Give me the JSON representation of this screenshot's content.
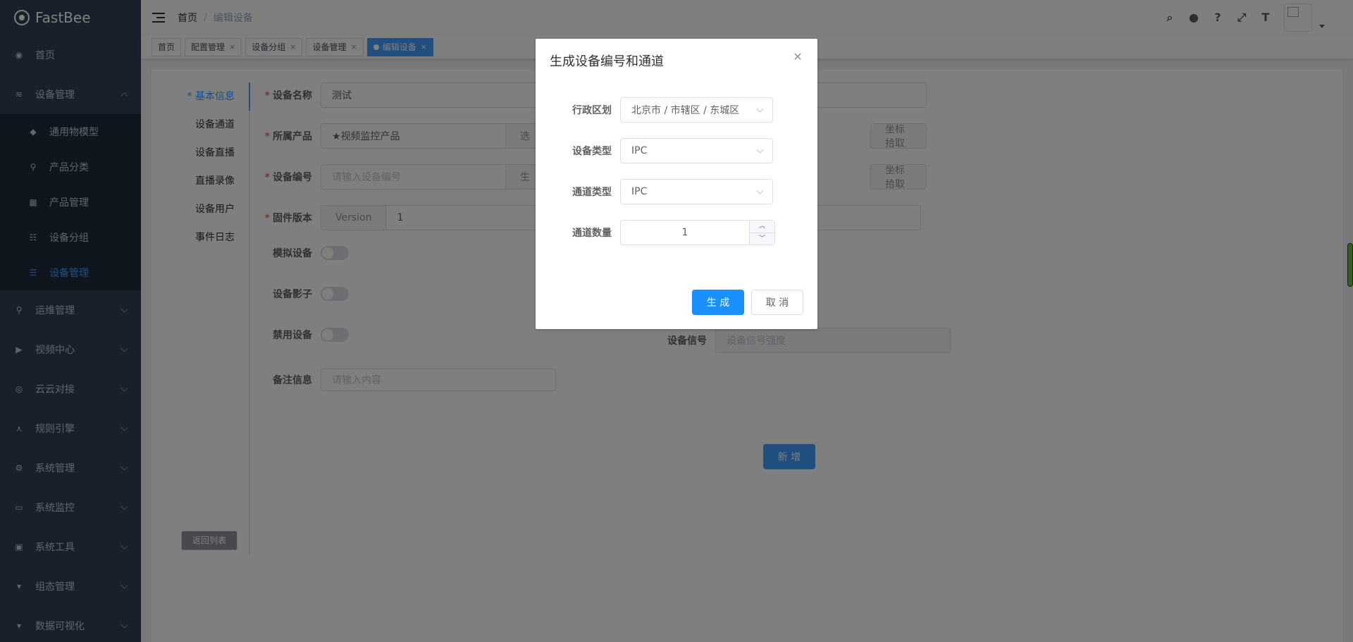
{
  "app": {
    "name": "FastBee"
  },
  "sidebar": {
    "items": [
      {
        "label": "首页",
        "icon": "dashboard-icon"
      },
      {
        "label": "设备管理",
        "icon": "layers-icon",
        "expanded": true,
        "children": [
          {
            "label": "通用物模型",
            "icon": "cube-icon"
          },
          {
            "label": "产品分类",
            "icon": "tree-icon"
          },
          {
            "label": "产品管理",
            "icon": "grid-icon"
          },
          {
            "label": "设备分组",
            "icon": "group-icon"
          },
          {
            "label": "设备管理",
            "icon": "list-icon",
            "active": true
          }
        ]
      },
      {
        "label": "运维管理",
        "icon": "tree-icon"
      },
      {
        "label": "视频中心",
        "icon": "video-icon"
      },
      {
        "label": "云云对接",
        "icon": "eye-icon"
      },
      {
        "label": "规则引擎",
        "icon": "share-icon"
      },
      {
        "label": "系统管理",
        "icon": "gear-icon"
      },
      {
        "label": "系统监控",
        "icon": "monitor-icon"
      },
      {
        "label": "系统工具",
        "icon": "toolbox-icon"
      },
      {
        "label": "组态管理",
        "icon": "chat-icon"
      },
      {
        "label": "数据可视化",
        "icon": "chat-icon"
      }
    ]
  },
  "navbar": {
    "breadcrumb": [
      "首页",
      "编辑设备"
    ],
    "icons": [
      "search-icon",
      "github-icon",
      "help-icon",
      "fullscreen-icon",
      "font-size-icon"
    ]
  },
  "tags": [
    {
      "label": "首页",
      "closable": false
    },
    {
      "label": "配置管理",
      "closable": true
    },
    {
      "label": "设备分组",
      "closable": true
    },
    {
      "label": "设备管理",
      "closable": true
    },
    {
      "label": "编辑设备",
      "closable": true,
      "active": true
    }
  ],
  "side_tabs": [
    "* 基本信息",
    "设备通道",
    "设备直播",
    "直播录像",
    "设备用户",
    "事件日志"
  ],
  "form": {
    "device_name": {
      "label": "设备名称",
      "value": "测试"
    },
    "product": {
      "label": "所属产品",
      "value": "★视频监控产品",
      "button": "选"
    },
    "device_no": {
      "label": "设备编号",
      "placeholder": "请输入设备编号",
      "button": "生"
    },
    "firmware": {
      "label": "固件版本",
      "prepend": "Version",
      "value": "1"
    },
    "simulate": {
      "label": "模拟设备"
    },
    "shadow": {
      "label": "设备影子"
    },
    "disable": {
      "label": "禁用设备"
    },
    "remark": {
      "label": "备注信息",
      "placeholder": "请输入内容"
    },
    "signal": {
      "label": "设备信号",
      "placeholder": "设备信号强度"
    },
    "coord_button": "坐标拾取",
    "back_button": "返回列表",
    "add_button": "新 增"
  },
  "dialog": {
    "title": "生成设备编号和通道",
    "region": {
      "label": "行政区划",
      "value": "北京市 / 市辖区 / 东城区"
    },
    "device_type": {
      "label": "设备类型",
      "value": "IPC"
    },
    "channel_type": {
      "label": "通道类型",
      "value": "IPC"
    },
    "channel_count": {
      "label": "通道数量",
      "value": "1"
    },
    "ok_button": "生 成",
    "cancel_button": "取 消"
  }
}
